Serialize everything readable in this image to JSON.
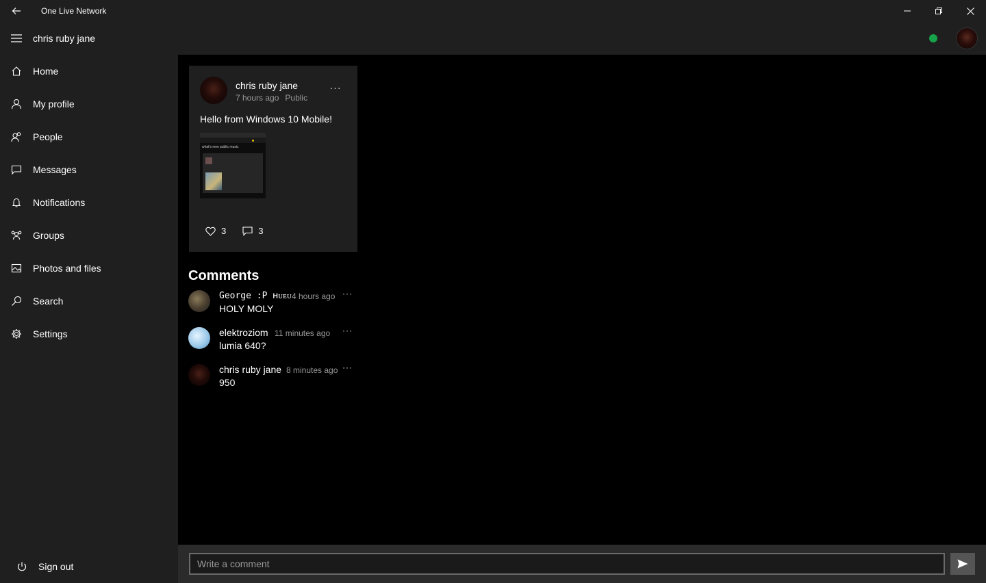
{
  "window": {
    "title": "One Live Network"
  },
  "header": {
    "title": "chris ruby jane",
    "status_color": "#16a34a"
  },
  "sidebar": {
    "items": [
      {
        "label": "Home",
        "icon": "home-icon"
      },
      {
        "label": "My profile",
        "icon": "person-icon"
      },
      {
        "label": "People",
        "icon": "people-icon"
      },
      {
        "label": "Messages",
        "icon": "message-icon"
      },
      {
        "label": "Notifications",
        "icon": "bell-icon"
      },
      {
        "label": "Groups",
        "icon": "groups-icon"
      },
      {
        "label": "Photos and files",
        "icon": "photo-icon"
      },
      {
        "label": "Search",
        "icon": "search-icon"
      },
      {
        "label": "Settings",
        "icon": "gear-icon"
      }
    ],
    "signout_label": "Sign out"
  },
  "post": {
    "author": "chris ruby jane",
    "time": "7 hours ago",
    "visibility": "Public",
    "text": "Hello from Windows 10 Mobile!",
    "image_tabs": "what's new   public   music",
    "likes": "3",
    "comments": "3"
  },
  "comments": {
    "title": "Comments",
    "items": [
      {
        "author": "George :P ʜᴜᴇᴜ",
        "time": "4 hours ago",
        "text": "HOLY MOLY"
      },
      {
        "author": "elektroziom",
        "time": "11 minutes ago",
        "text": "lumia 640?"
      },
      {
        "author": "chris ruby jane",
        "time": "8 minutes ago",
        "text": "950"
      }
    ]
  },
  "composer": {
    "placeholder": "Write a comment"
  }
}
